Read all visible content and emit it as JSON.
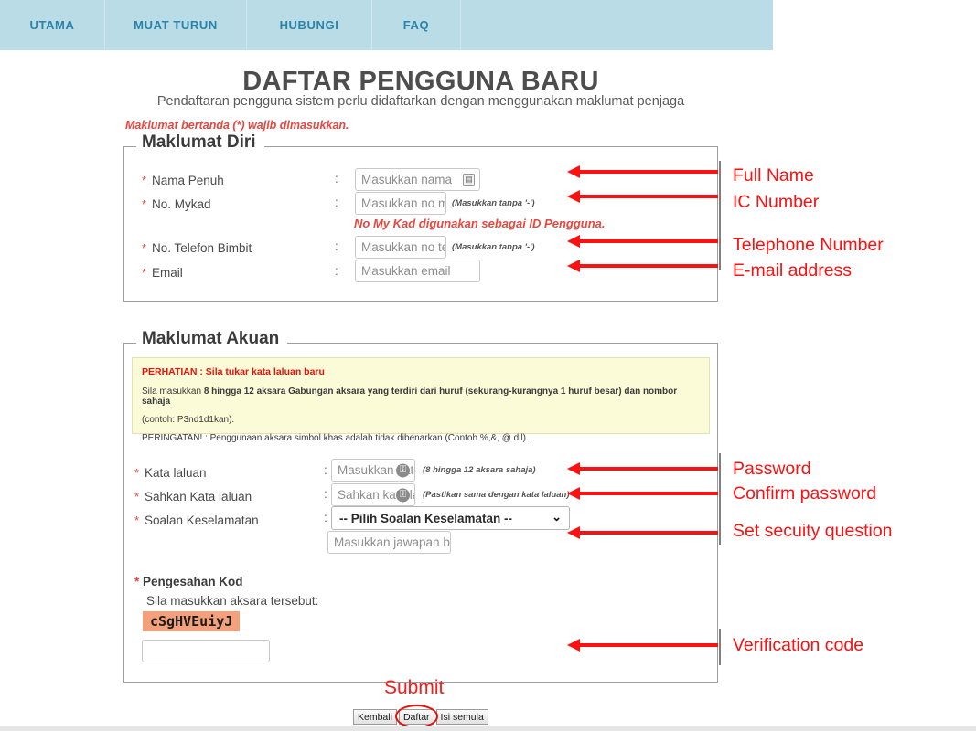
{
  "nav": {
    "items": [
      {
        "label": "UTAMA"
      },
      {
        "label": "MUAT TURUN"
      },
      {
        "label": "HUBUNGI"
      },
      {
        "label": "FAQ"
      }
    ]
  },
  "header": {
    "title": "DAFTAR PENGGUNA BARU",
    "subtitle": "Pendaftaran pengguna sistem perlu didaftarkan dengan menggunakan maklumat penjaga",
    "required_note": "Maklumat bertanda (*) wajib dimasukkan."
  },
  "personal": {
    "legend": "Maklumat Diri",
    "colon": ":",
    "fields": [
      {
        "label": "Nama Penuh",
        "placeholder": "Masukkan nama",
        "hint": ""
      },
      {
        "label": "No. Mykad",
        "placeholder": "Masukkan no m",
        "hint": "(Masukkan tanpa '-')"
      },
      {
        "label": "No. Telefon Bimbit",
        "placeholder": "Masukkan no te",
        "hint": "(Masukkan tanpa '-')"
      },
      {
        "label": "Email",
        "placeholder": "Masukkan email",
        "hint": ""
      }
    ],
    "mykad_note": "No My Kad digunakan sebagai ID Pengguna."
  },
  "account": {
    "legend": "Maklumat Akuan",
    "colon": ":",
    "notice": {
      "title": "PERHATIAN : Sila tukar kata laluan baru",
      "line1_a": "Sila masukkan ",
      "line1_b": "8 hingga 12 aksara Gabungan aksara yang terdiri dari huruf (sekurang-kurangnya 1 huruf besar) dan nombor sahaja",
      "line2": "(contoh: P3nd1d1kan).",
      "line3": "PERINGATAN! : Penggunaan aksara simbol khas adalah tidak dibenarkan (Contoh %,&, @ dll)."
    },
    "fields": [
      {
        "label": "Kata laluan",
        "placeholder": "Masukkan kata",
        "hint": "(8 hingga 12 aksara sahaja)"
      },
      {
        "label": "Sahkan Kata laluan",
        "placeholder": "Sahkan kata la",
        "hint": "(Pastikan sama dengan kata laluan)"
      },
      {
        "label": "Soalan Keselamatan",
        "placeholder": "",
        "hint": ""
      }
    ],
    "security_select_value": "-- Pilih Soalan Keselamatan --",
    "answer_placeholder": "Masukkan jawapan ba",
    "captcha": {
      "label": "Pengesahan Kod",
      "sub": "Sila masukkan aksara tersebut:",
      "code": "cSgHVEuiyJ",
      "input_value": ""
    }
  },
  "buttons": {
    "back": "Kembali",
    "register": "Daftar",
    "reset": "Isi semula"
  },
  "annotations": {
    "submit": "Submit",
    "items": [
      {
        "text": "Full Name"
      },
      {
        "text": "IC Number"
      },
      {
        "text": "Telephone Number"
      },
      {
        "text": "E-mail address"
      },
      {
        "text": "Password"
      },
      {
        "text": "Confirm password"
      },
      {
        "text": "Set secuity question"
      },
      {
        "text": "Verification code"
      }
    ]
  },
  "colors": {
    "nav_bg": "#b9dce6",
    "nav_text": "#2a83a8",
    "required_red": "#e8473f",
    "annotation_red": "#fb1111",
    "notice_bg": "#fcfbd8",
    "captcha_bg": "#f4a07a"
  }
}
